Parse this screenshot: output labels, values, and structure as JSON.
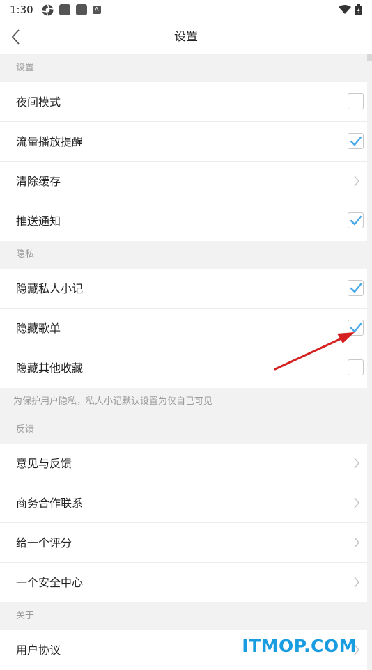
{
  "status_bar": {
    "time": "1:30",
    "notif_icon_letter": "A"
  },
  "header": {
    "title": "设置"
  },
  "sections": {
    "settings": {
      "title": "设置",
      "items": [
        {
          "label": "夜间模式",
          "control": "checkbox",
          "checked": false
        },
        {
          "label": "流量播放提醒",
          "control": "checkbox",
          "checked": true
        },
        {
          "label": "清除缓存",
          "control": "chevron"
        },
        {
          "label": "推送通知",
          "control": "checkbox",
          "checked": true
        }
      ]
    },
    "privacy": {
      "title": "隐私",
      "items": [
        {
          "label": "隐藏私人小记",
          "control": "checkbox",
          "checked": true
        },
        {
          "label": "隐藏歌单",
          "control": "checkbox",
          "checked": true
        },
        {
          "label": "隐藏其他收藏",
          "control": "checkbox",
          "checked": false
        }
      ],
      "note": "为保护用户隐私，私人小记默认设置为仅自己可见"
    },
    "feedback": {
      "title": "反馈",
      "items": [
        {
          "label": "意见与反馈",
          "control": "chevron"
        },
        {
          "label": "商务合作联系",
          "control": "chevron"
        },
        {
          "label": "给一个评分",
          "control": "chevron"
        },
        {
          "label": "一个安全中心",
          "control": "chevron"
        }
      ]
    },
    "about": {
      "title": "关于",
      "items": [
        {
          "label": "用户协议",
          "control": "chevron"
        }
      ]
    }
  },
  "watermark": "ITMOP.COM",
  "colors": {
    "accent_check": "#4aa9e8",
    "annotation_arrow": "#d42020",
    "watermark": "#1a9de0"
  }
}
